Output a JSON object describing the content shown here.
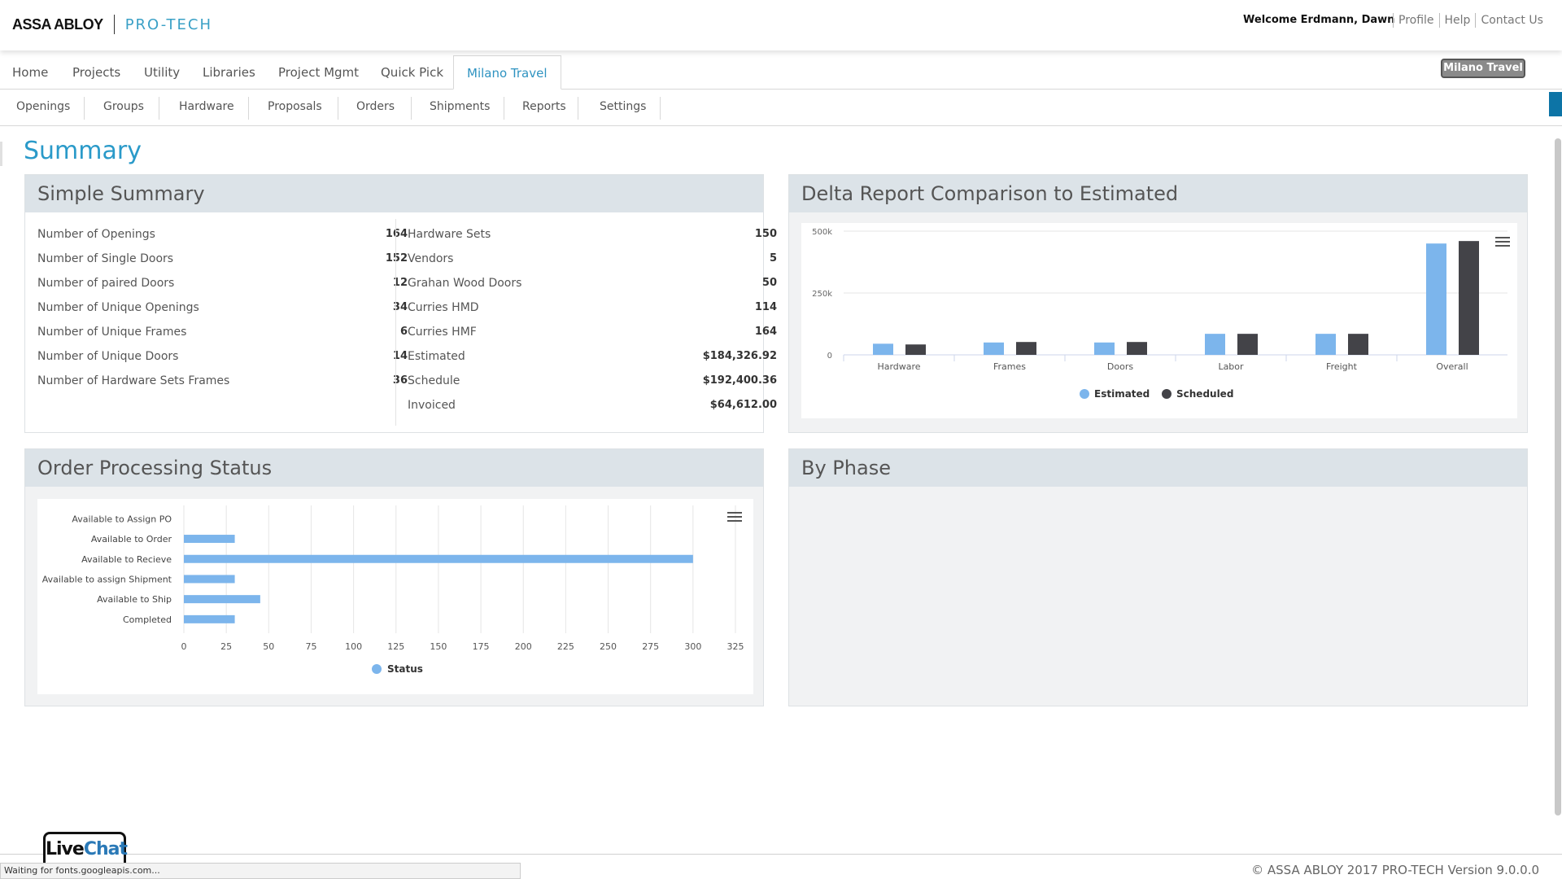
{
  "header": {
    "brand": "ASSA ABLOY",
    "product": "PRO-TECH",
    "welcome": "Welcome Erdmann, Dawn",
    "links": [
      "Profile",
      "Help",
      "Contact Us"
    ]
  },
  "main_nav": {
    "tabs": [
      "Home",
      "Projects",
      "Utility",
      "Libraries",
      "Project Mgmt",
      "Quick Pick",
      "Milano Travel"
    ],
    "active": "Milano Travel",
    "project_badge": "Milano Travel"
  },
  "sub_nav": {
    "items": [
      "Openings",
      "Groups",
      "Hardware",
      "Proposals",
      "Orders",
      "Shipments",
      "Reports",
      "Settings"
    ]
  },
  "page": {
    "title": "Summary"
  },
  "simple_summary": {
    "title": "Simple Summary",
    "left": [
      {
        "label": "Number of Openings",
        "value": "164"
      },
      {
        "label": "Number of Single Doors",
        "value": "152"
      },
      {
        "label": "Number of paired Doors",
        "value": "12"
      },
      {
        "label": "Number of Unique Openings",
        "value": "34"
      },
      {
        "label": "Number of Unique Frames",
        "value": "6"
      },
      {
        "label": "Number of Unique Doors",
        "value": "14"
      },
      {
        "label": "Number of Hardware Sets Frames",
        "value": "36"
      }
    ],
    "right": [
      {
        "label": "Hardware Sets",
        "value": "150"
      },
      {
        "label": "Vendors",
        "value": "5"
      },
      {
        "label": "Grahan Wood Doors",
        "value": "50"
      },
      {
        "label": "Curries HMD",
        "value": "114"
      },
      {
        "label": "Curries HMF",
        "value": "164"
      },
      {
        "label": "Estimated",
        "value": "$184,326.92"
      },
      {
        "label": "Schedule",
        "value": "$192,400.36"
      },
      {
        "label": "Invoiced",
        "value": "$64,612.00"
      }
    ]
  },
  "delta_report": {
    "title": "Delta Report Comparison to Estimated"
  },
  "order_status": {
    "title": "Order Processing Status"
  },
  "by_phase": {
    "title": "By Phase"
  },
  "footer": {
    "copyright": "© ASSA ABLOY 2017 PRO-TECH Version 9.0.0.0",
    "livechat_live": "Live",
    "livechat_chat": "Chat",
    "status_text": "Waiting for fonts.googleapis.com..."
  },
  "colors": {
    "accent": "#2a9ac9",
    "estimated": "#7cb5ec",
    "scheduled": "#434348"
  },
  "chart_data": [
    {
      "type": "bar",
      "categories": [
        "Hardware",
        "Frames",
        "Doors",
        "Labor",
        "Freight",
        "Overall"
      ],
      "series": [
        {
          "name": "Estimated",
          "values": [
            45000,
            50000,
            50000,
            85000,
            85000,
            450000
          ]
        },
        {
          "name": "Scheduled",
          "values": [
            42000,
            52000,
            52000,
            85000,
            85000,
            460000
          ]
        }
      ],
      "yticks": [
        "0",
        "250k",
        "500k"
      ],
      "ylim": [
        0,
        500000
      ],
      "legend": "bottom-center",
      "grid": true
    },
    {
      "type": "bar",
      "orientation": "horizontal",
      "categories": [
        "Available to Assign PO",
        "Available to Order",
        "Available to Recieve",
        "Available to assign Shipment",
        "Available to Ship",
        "Completed"
      ],
      "series": [
        {
          "name": "Status",
          "values": [
            0,
            30,
            300,
            30,
            45,
            30
          ]
        }
      ],
      "xticks": [
        "0",
        "25",
        "50",
        "75",
        "100",
        "125",
        "150",
        "175",
        "200",
        "225",
        "250",
        "275",
        "300",
        "325"
      ],
      "xlim": [
        0,
        325
      ],
      "legend": "bottom-center",
      "grid": true
    }
  ]
}
